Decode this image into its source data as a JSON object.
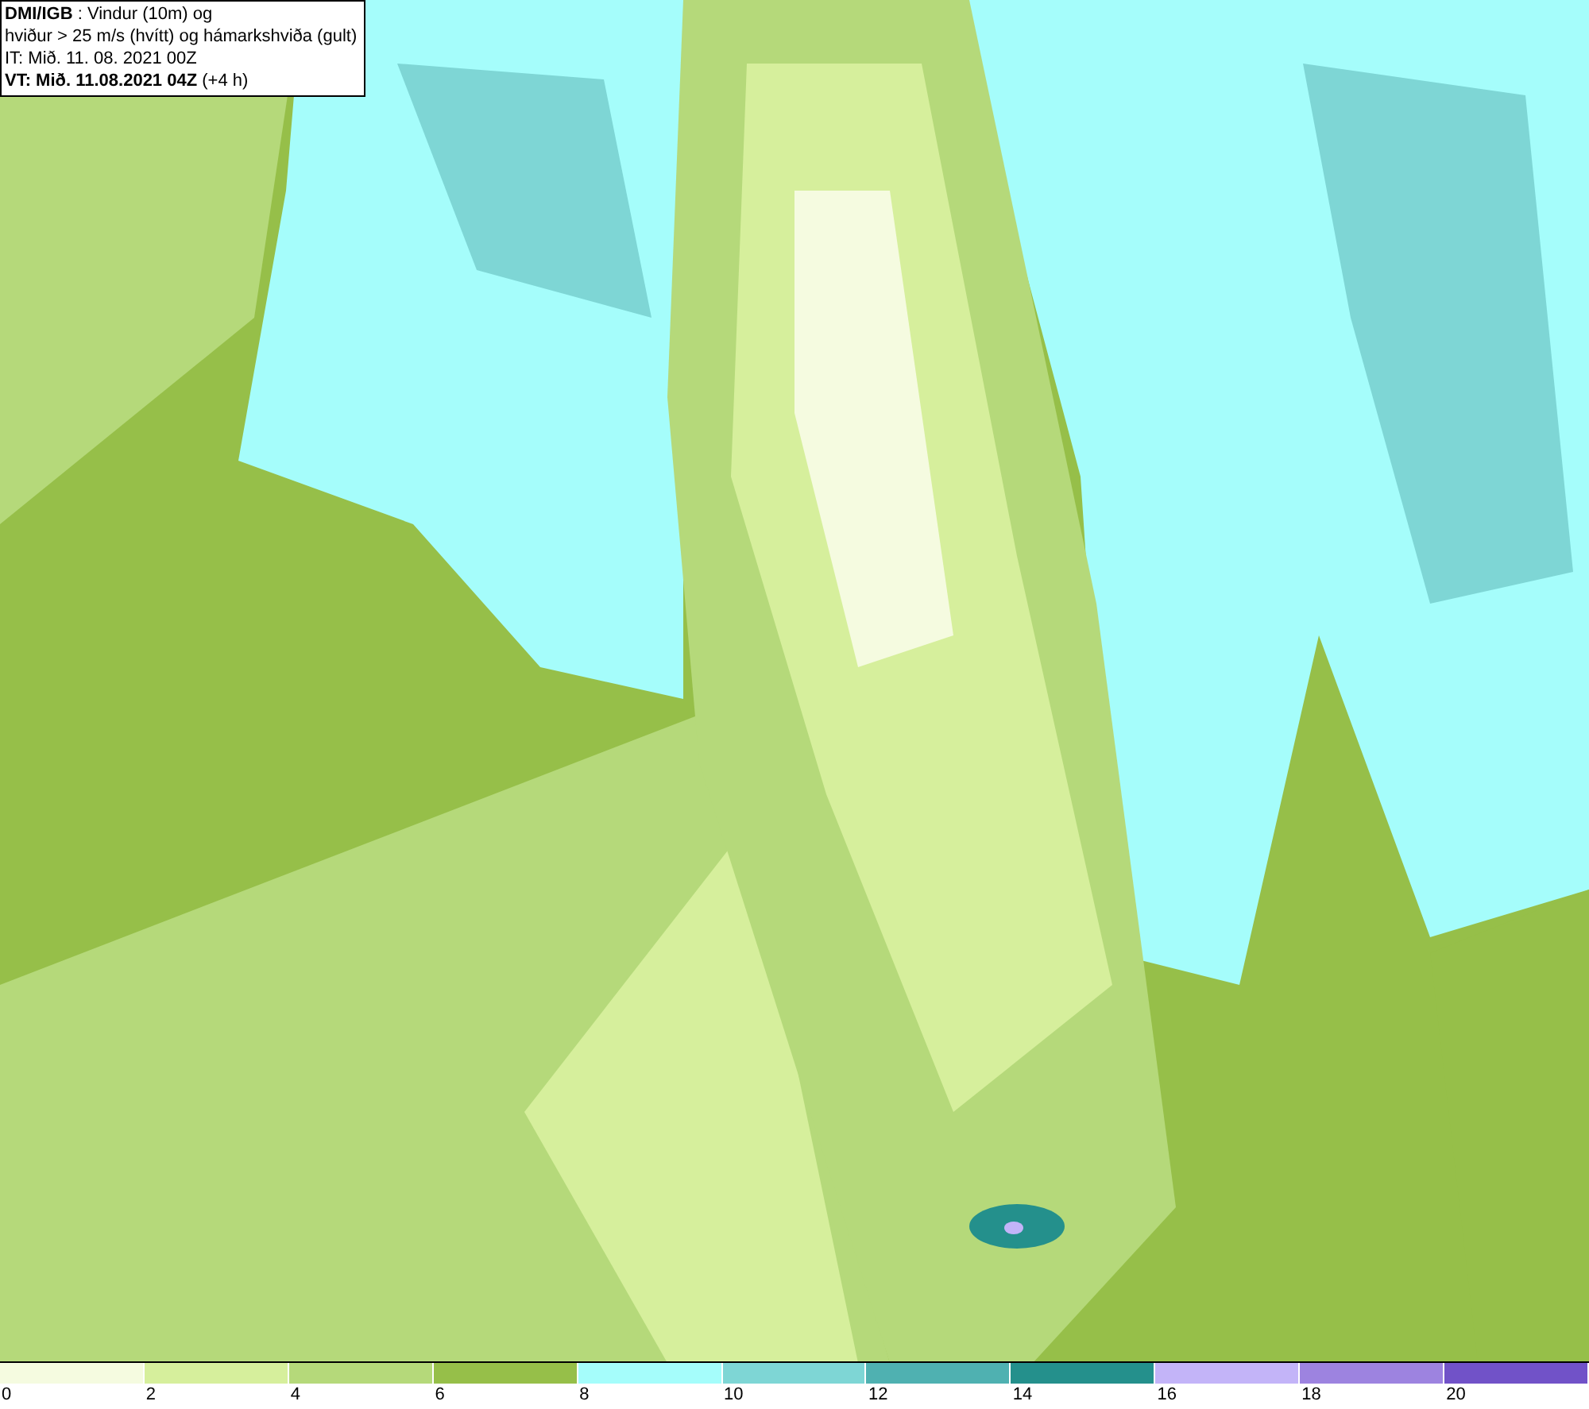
{
  "header": {
    "lines": [
      "**DMI/IGB** : Vindur (10m) og",
      "hviður > 25 m/s (hvítt) og hámarkshviða (gult)",
      "IT: Mið. 11. 08. 2021 00Z",
      "**VT: Mið. 11.08.2021 04Z** (+4 h)"
    ]
  },
  "legend": [
    {
      "color": "#f5fbe0",
      "label": "0"
    },
    {
      "color": "#d6ef9c",
      "label": "2"
    },
    {
      "color": "#b5d97a",
      "label": "4"
    },
    {
      "color": "#96bf49",
      "label": "6"
    },
    {
      "color": "#a5fdfb",
      "label": "8"
    },
    {
      "color": "#7ed6d5",
      "label": "10"
    },
    {
      "color": "#4fb1b1",
      "label": "12"
    },
    {
      "color": "#24908c",
      "label": "14"
    },
    {
      "color": "#c3b4f8",
      "label": "16"
    },
    {
      "color": "#9d83e0",
      "label": "18"
    },
    {
      "color": "#7152c8",
      "label": "20"
    }
  ]
}
